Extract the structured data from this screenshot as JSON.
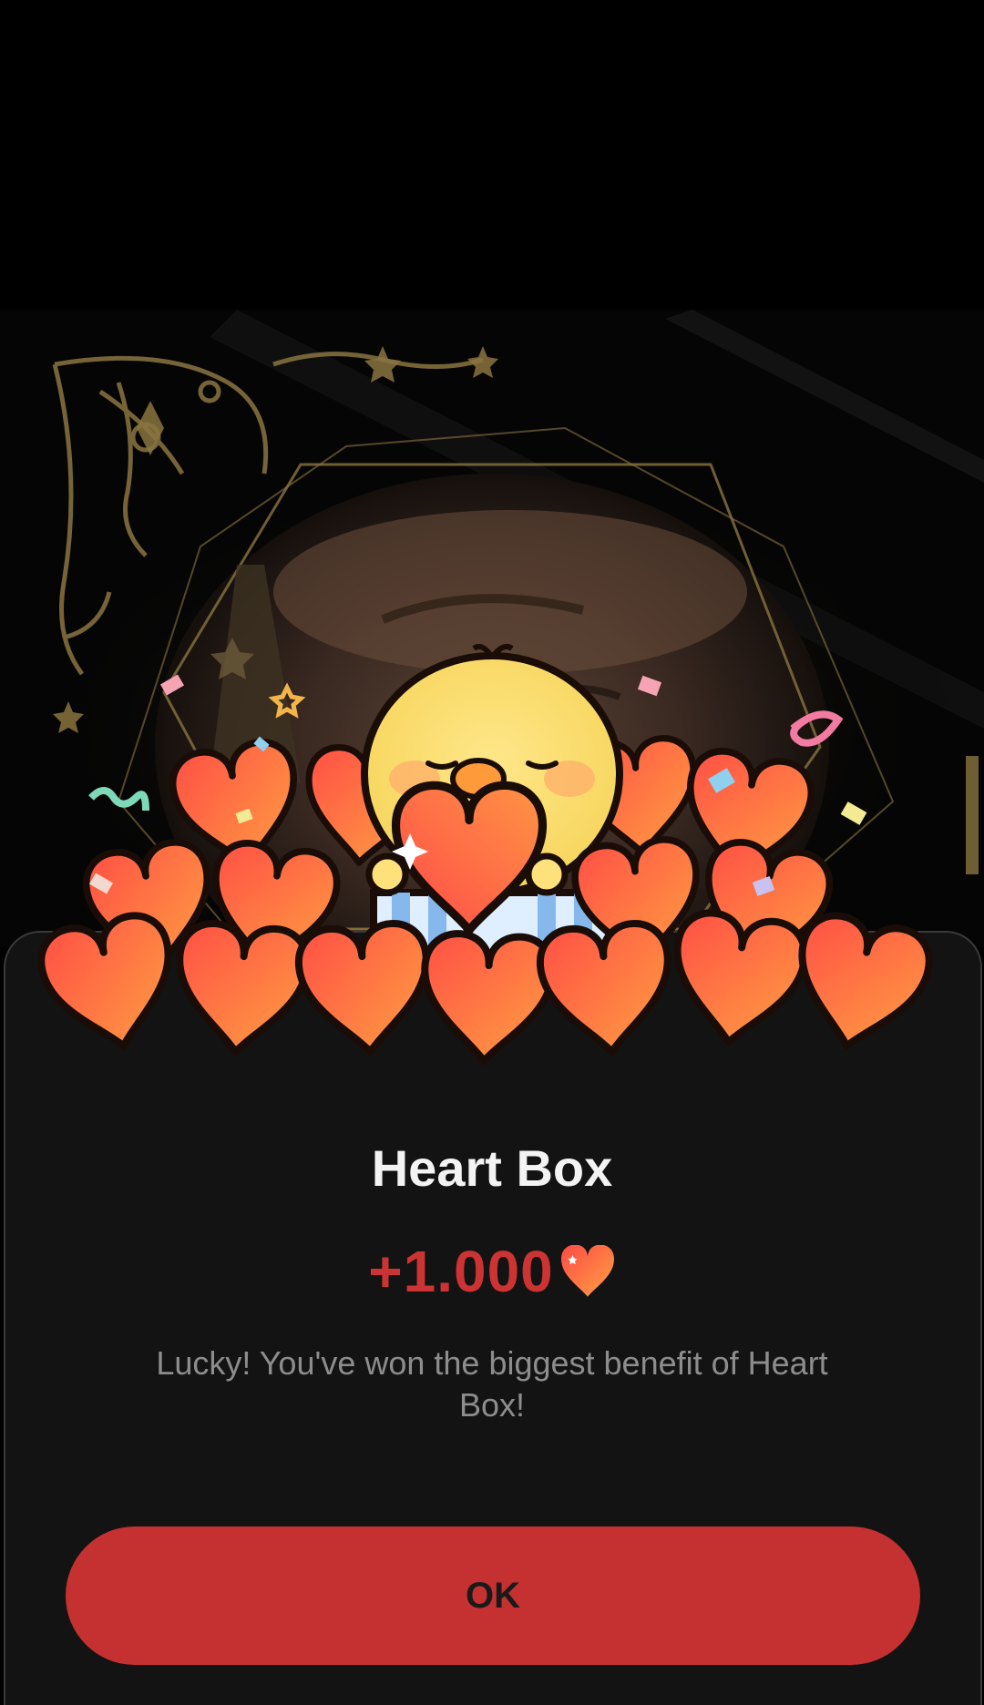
{
  "dialog": {
    "title": "Heart Box",
    "reward_amount": "+1.000",
    "message": "Lucky! You've won the biggest benefit of Heart Box!",
    "ok_label": "OK"
  },
  "icons": {
    "reward": "heart-icon",
    "mascot": "chick-holding-heart-illustration"
  },
  "colors": {
    "accent": "#c43130",
    "reward_text": "#cc3333",
    "sheet_bg": "#131313",
    "frame_gold": "#8a7440",
    "heart_top": "#ff5f4a",
    "heart_bottom": "#ff9a3f"
  }
}
